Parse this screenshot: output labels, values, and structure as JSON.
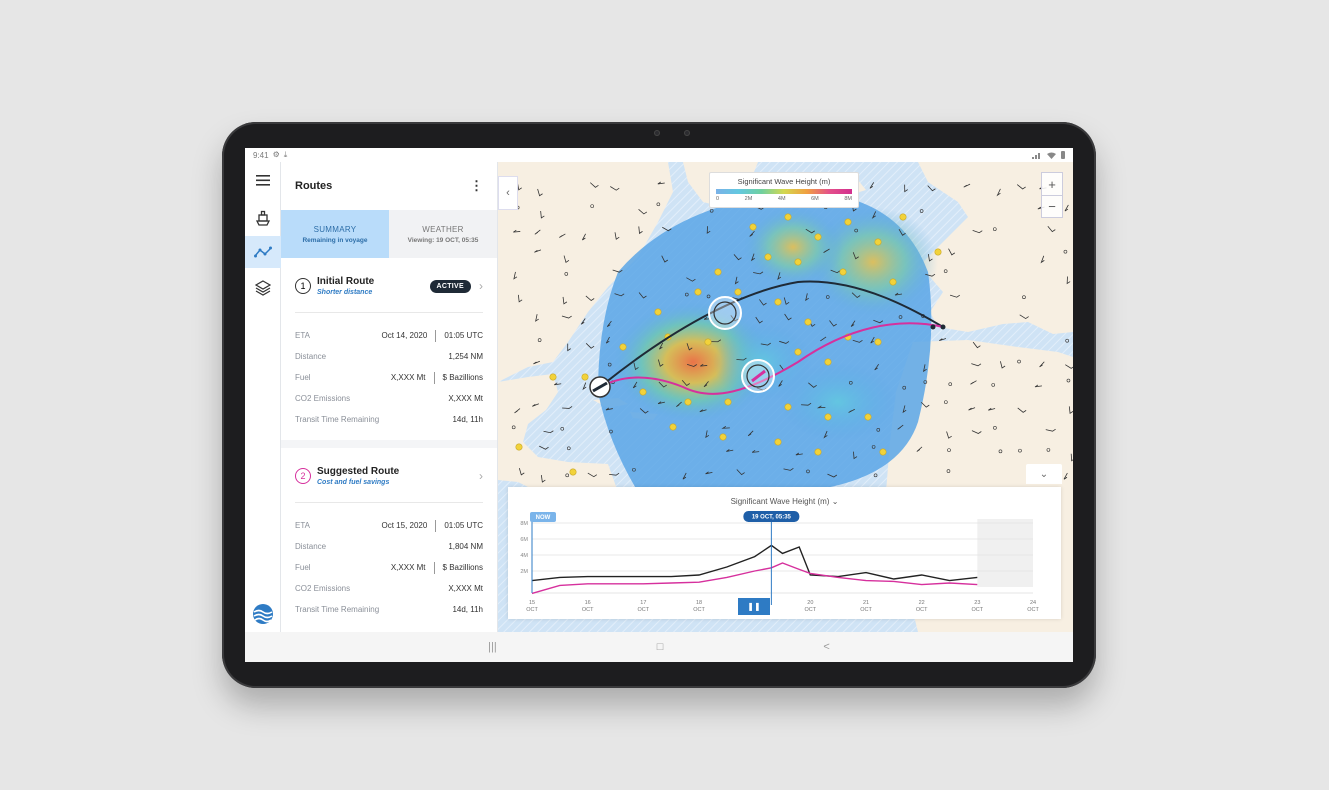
{
  "status_bar": {
    "time": "9:41"
  },
  "panel": {
    "title": "Routes",
    "tabs": [
      {
        "label": "SUMMARY",
        "sub": "Remaining in voyage"
      },
      {
        "label": "WEATHER",
        "sub": "Viewing: 19 OCT, 05:35"
      }
    ],
    "routes": [
      {
        "num": "1",
        "name": "Initial Route",
        "sub": "Shorter distance",
        "badge": "ACTIVE",
        "eta_date": "Oct 14, 2020",
        "eta_time": "01:05 UTC",
        "distance": "1,254 NM",
        "fuel_mt": "X,XXX Mt",
        "fuel_cost": "$ Bazillions",
        "co2": "X,XXX Mt",
        "transit": "14d, 11h"
      },
      {
        "num": "2",
        "name": "Suggested Route",
        "sub": "Cost and fuel savings",
        "eta_date": "Oct 15, 2020",
        "eta_time": "01:05 UTC",
        "distance": "1,804 NM",
        "fuel_mt": "X,XXX Mt",
        "fuel_cost": "$ Bazillions",
        "co2": "X,XXX Mt",
        "transit": "14d, 11h"
      }
    ],
    "labels": {
      "eta": "ETA",
      "distance": "Distance",
      "fuel": "Fuel",
      "co2": "CO2 Emissions",
      "transit": "Transit Time Remaining"
    }
  },
  "map": {
    "legend_title": "Significant Wave Height (m)",
    "legend_ticks": [
      "0",
      "2M",
      "4M",
      "6M",
      "8M"
    ],
    "colors": {
      "initial_route": "#1f2a36",
      "suggested_route": "#d6309d",
      "accent": "#2e7bc4"
    }
  },
  "chart_data": {
    "type": "line",
    "title": "Significant Wave Height (m)",
    "y_ticks": [
      "8M",
      "6M",
      "4M",
      "2M"
    ],
    "ylim": [
      0,
      8
    ],
    "x_ticks": [
      {
        "day": "15",
        "month": "OCT"
      },
      {
        "day": "16",
        "month": "OCT"
      },
      {
        "day": "17",
        "month": "OCT"
      },
      {
        "day": "18",
        "month": "OCT"
      },
      {
        "day": "19",
        "month": "OCT"
      },
      {
        "day": "20",
        "month": "OCT"
      },
      {
        "day": "21",
        "month": "OCT"
      },
      {
        "day": "22",
        "month": "OCT"
      },
      {
        "day": "23",
        "month": "OCT"
      },
      {
        "day": "24",
        "month": "OCT"
      }
    ],
    "x": [
      15,
      15.5,
      16,
      16.5,
      17,
      17.5,
      18,
      18.5,
      19,
      19.3,
      19.5,
      19.8,
      20,
      20.5,
      21,
      21.5,
      22,
      22.5,
      23
    ],
    "series": [
      {
        "values": [
          0.8,
          1.2,
          1.3,
          1.3,
          1.3,
          1.3,
          1.5,
          2.5,
          3.8,
          5.2,
          4.2,
          5.0,
          1.5,
          1.3,
          1.8,
          1.0,
          1.5,
          0.8,
          1.2
        ],
        "color": "#222222"
      },
      {
        "values": [
          -0.8,
          0.2,
          0.4,
          0.4,
          0.4,
          0.5,
          0.6,
          1.2,
          2.0,
          2.4,
          3.0,
          2.2,
          1.7,
          1.2,
          0.8,
          0.7,
          0.3,
          0.5,
          0.3
        ],
        "color": "#d6309d"
      }
    ],
    "now_label": "NOW",
    "cursor_label": "19 OCT, 05:35",
    "cursor_x": 19.3,
    "forecast_end_x": 23
  },
  "dock": {
    "play_icon": "pause-icon"
  },
  "nav": {
    "recents": "|||",
    "home": "□",
    "back": "<"
  }
}
